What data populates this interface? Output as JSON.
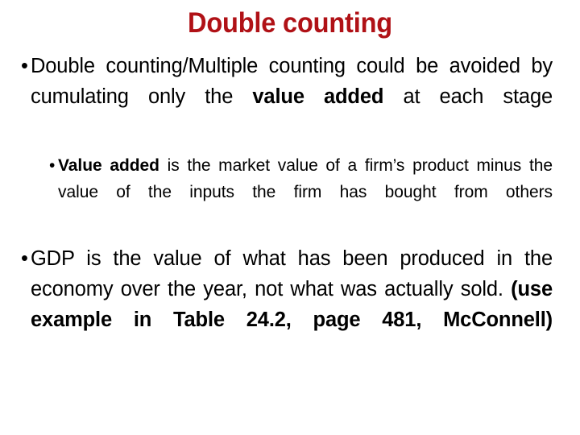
{
  "slide": {
    "title": "Double counting",
    "title_color": "#b01116",
    "background_color": "#ffffff",
    "text_color": "#000000",
    "bullet_glyph": "•"
  },
  "content": {
    "blocks": [
      {
        "level": 1,
        "id": "double-counting-bullet",
        "runs": [
          {
            "text": "Double counting/Multiple counting could be avoided by cumulating only the ",
            "bold": false
          },
          {
            "text": "value added",
            "bold": true
          },
          {
            "text": " at each stage",
            "bold": false
          }
        ],
        "plain": "Double counting/Multiple counting could be avoided by cumulating only the value added at each stage"
      },
      {
        "level": 2,
        "id": "value-added-bullet",
        "runs": [
          {
            "text": "Value added",
            "bold": true
          },
          {
            "text": " is the market value of a firm’s product minus the value of the inputs the firm has bought from others",
            "bold": false
          }
        ],
        "plain": "Value added is the market value of a firm’s product minus the value of the inputs the firm has bought from others"
      },
      {
        "level": 1,
        "id": "gdp-bullet",
        "runs": [
          {
            "text": "GDP is the value of what has been produced in the economy over the year, not what was actually sold. ",
            "bold": false
          },
          {
            "text": "(use example in Table 24.2, page 481, McConnell)",
            "bold": true
          }
        ],
        "plain": "GDP is the value of what has been produced in the economy over the year, not what was actually sold. (use example in Table 24.2, page 481, McConnell)"
      }
    ]
  }
}
